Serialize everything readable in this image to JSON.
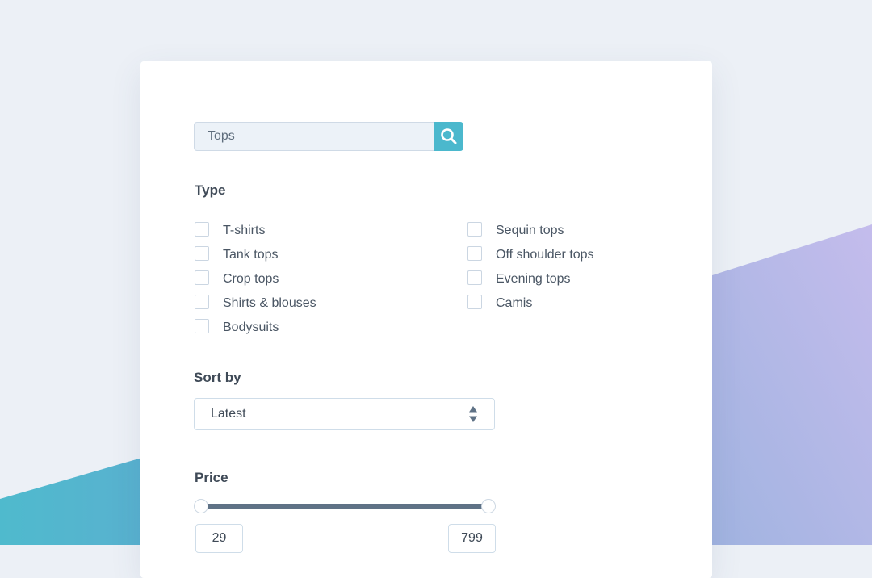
{
  "search": {
    "value": "Tops",
    "icon": "search-icon"
  },
  "type_section": {
    "title": "Type",
    "left_options": [
      {
        "label": "T-shirts",
        "checked": false
      },
      {
        "label": "Tank tops",
        "checked": false
      },
      {
        "label": "Crop tops",
        "checked": false
      },
      {
        "label": "Shirts & blouses",
        "checked": false
      },
      {
        "label": "Bodysuits",
        "checked": false
      }
    ],
    "right_options": [
      {
        "label": "Sequin tops",
        "checked": false
      },
      {
        "label": "Off shoulder tops",
        "checked": false
      },
      {
        "label": "Evening tops",
        "checked": false
      },
      {
        "label": "Camis",
        "checked": false
      }
    ]
  },
  "sort_section": {
    "title": "Sort by",
    "selected": "Latest"
  },
  "price_section": {
    "title": "Price",
    "min": "29",
    "max": "799"
  },
  "colors": {
    "accent": "#4bb8cd",
    "slider": "#5f7286",
    "background": "#ecf0f6",
    "teal_shape": "#4bb8cd",
    "purple_shape": "#b4b6ea"
  }
}
